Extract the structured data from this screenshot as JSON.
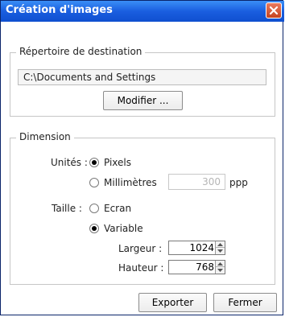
{
  "window": {
    "title": "Création d'images",
    "close_icon": "close-icon",
    "colors": {
      "titlebar": "#1a5ee0",
      "close": "#c5431f"
    }
  },
  "destination": {
    "legend": "Répertoire de destination",
    "path": "C:\\Documents and Settings",
    "modify_label": "Modifier ..."
  },
  "dimension": {
    "legend": "Dimension",
    "units_label": "Unités :",
    "unit_options": [
      {
        "label": "Pixels",
        "checked": true
      },
      {
        "label": "Millimètres",
        "checked": false
      }
    ],
    "resolution_value": "300",
    "resolution_unit": "ppp",
    "size_label": "Taille :",
    "size_options": [
      {
        "label": "Ecran",
        "checked": false
      },
      {
        "label": "Variable",
        "checked": true
      }
    ],
    "width_label": "Largeur :",
    "width_value": "1024",
    "height_label": "Hauteur :",
    "height_value": "768"
  },
  "actions": {
    "export_label": "Exporter",
    "close_label": "Fermer"
  }
}
